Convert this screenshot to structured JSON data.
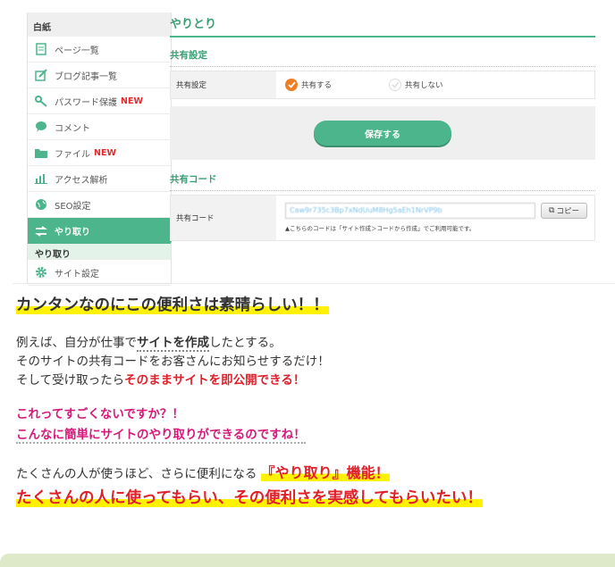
{
  "sidebar": {
    "header": "白紙",
    "items": [
      {
        "label": "ページ一覧",
        "icon": "page-icon",
        "new": ""
      },
      {
        "label": "ブログ記事一覧",
        "icon": "edit-icon",
        "new": ""
      },
      {
        "label": "パスワード保護",
        "icon": "key-icon",
        "new": "NEW"
      },
      {
        "label": "コメント",
        "icon": "comment-icon",
        "new": ""
      },
      {
        "label": "ファイル",
        "icon": "folder-icon",
        "new": "NEW"
      },
      {
        "label": "アクセス解析",
        "icon": "chart-icon",
        "new": ""
      },
      {
        "label": "SEO設定",
        "icon": "globe-icon",
        "new": ""
      },
      {
        "label": "やり取り",
        "icon": "exchange-icon",
        "new": ""
      }
    ],
    "sub_item": "やり取り",
    "last_item": {
      "label": "サイト設定",
      "icon": "gear-icon"
    }
  },
  "main": {
    "title": "やりとり",
    "share_section": {
      "title": "共有設定",
      "row_label": "共有設定",
      "option_on": "共有する",
      "option_off": "共有しない",
      "selected": "共有する"
    },
    "save_button": "保存する",
    "code_section": {
      "title": "共有コード",
      "row_label": "共有コード",
      "code_value": "Caw9r735c3Bp7xNdUuM8Hg5aEh1NrVP9b",
      "copy_button": "コピー",
      "note": "▲こちらのコードは「サイト作成＞コードから作成」でご利用可能です。"
    }
  },
  "article": {
    "heading": "カンタンなのにこの便利さは素晴らしい！！",
    "p1_a": "例えば、自分が仕事で",
    "p1_b": "サイトを作成",
    "p1_c": "したとする。",
    "p2": "そのサイトの共有コードをお客さんにお知らせするだけ！",
    "p3_a": "そして受け取ったら",
    "p3_b": "そのままサイトを即公開できる！",
    "pink1": "これってすごくないですか？！",
    "pink2": "こんなに簡単にサイトのやり取りができるのですね！",
    "p4_a": "たくさんの人が使うほど、さらに便利になる",
    "p4_b": "『やり取り』機能！",
    "final": "たくさんの人に使ってもらい、その便利さを実感してもらいたい！"
  },
  "colors": {
    "accent": "#4cb58c",
    "highlight": "#fff200",
    "red": "#e0202a",
    "pink": "#d6197a"
  }
}
